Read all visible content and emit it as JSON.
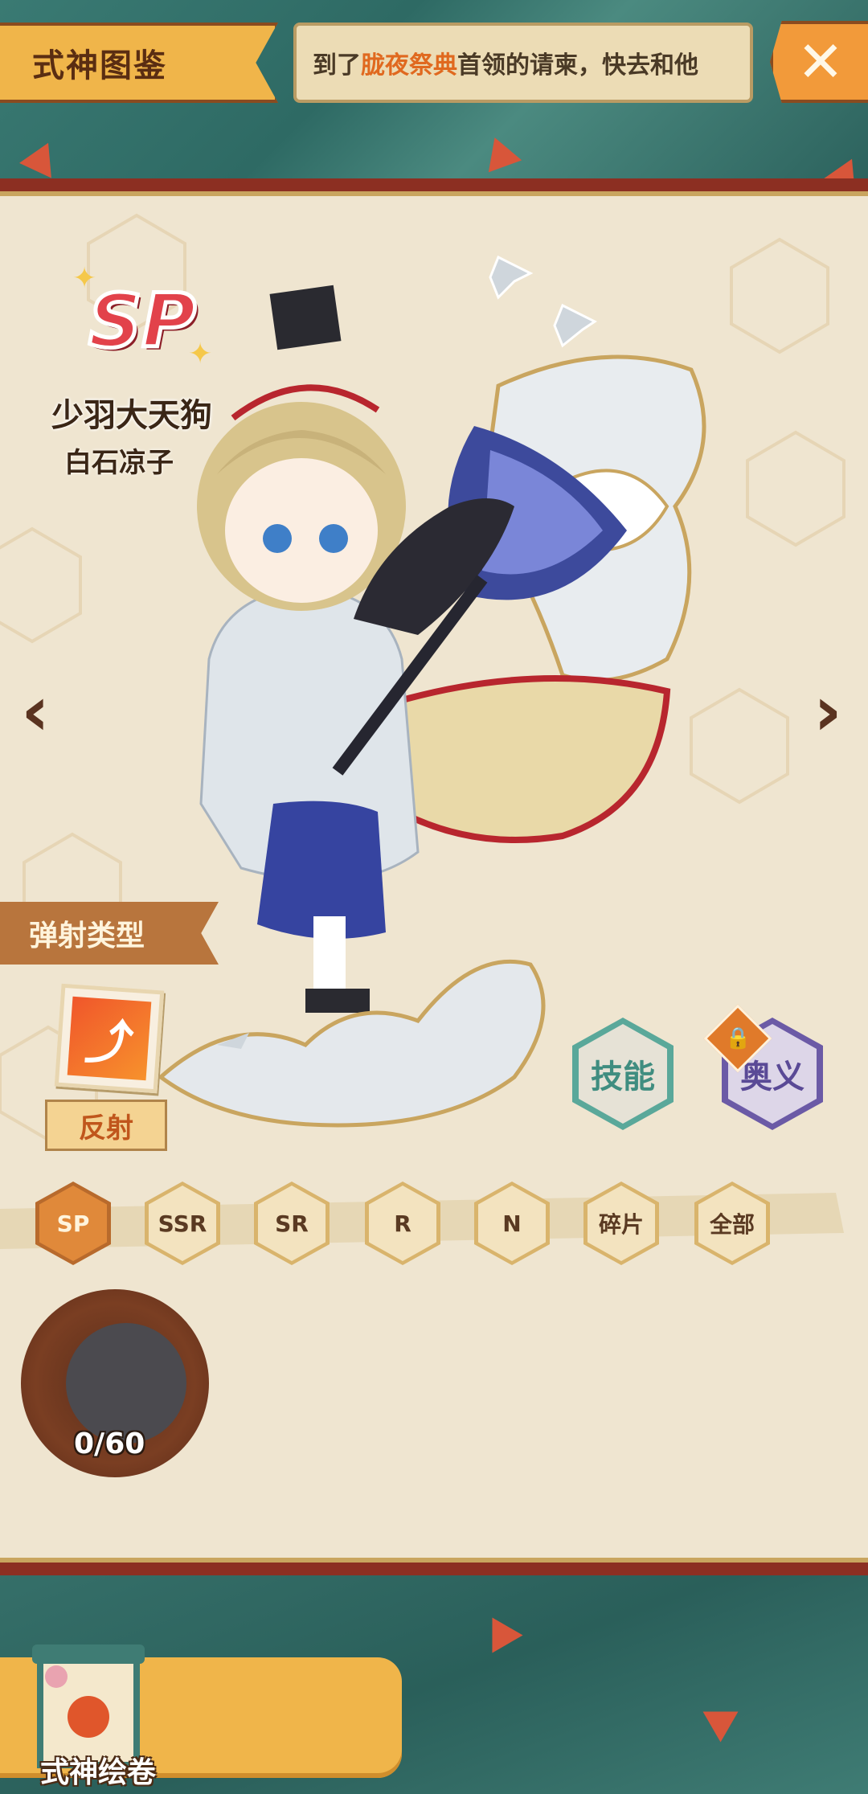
{
  "header": {
    "title": "式神图鉴",
    "marquee_prefix": "到了",
    "marquee_highlight": "胧夜祭典",
    "marquee_suffix": "首领的请柬，快去和他",
    "close_label": "✕"
  },
  "character": {
    "rarity": "SP",
    "name": "少羽大天狗",
    "voice_actor": "白石凉子"
  },
  "navigation": {
    "prev": "‹",
    "next": "›"
  },
  "type_section": {
    "heading": "弹射类型",
    "icon": "rebound-arrow-icon",
    "type_name": "反射"
  },
  "skills": {
    "skill_label": "技能",
    "ougi_label": "奥义",
    "ougi_locked": true
  },
  "filters": {
    "tabs": [
      "SP",
      "SSR",
      "SR",
      "R",
      "N",
      "碎片",
      "全部"
    ],
    "active_index": 0
  },
  "collection": {
    "count": "0/60"
  },
  "bottom": {
    "scroll_label": "式神绘卷"
  },
  "colors": {
    "banner": "#f0b54a",
    "accent": "#e0691f",
    "frame_red": "#8c2f22",
    "paper": "#efe5d0",
    "skill_teal": "#5aa89a",
    "ougi_purple": "#6b5aa6"
  }
}
